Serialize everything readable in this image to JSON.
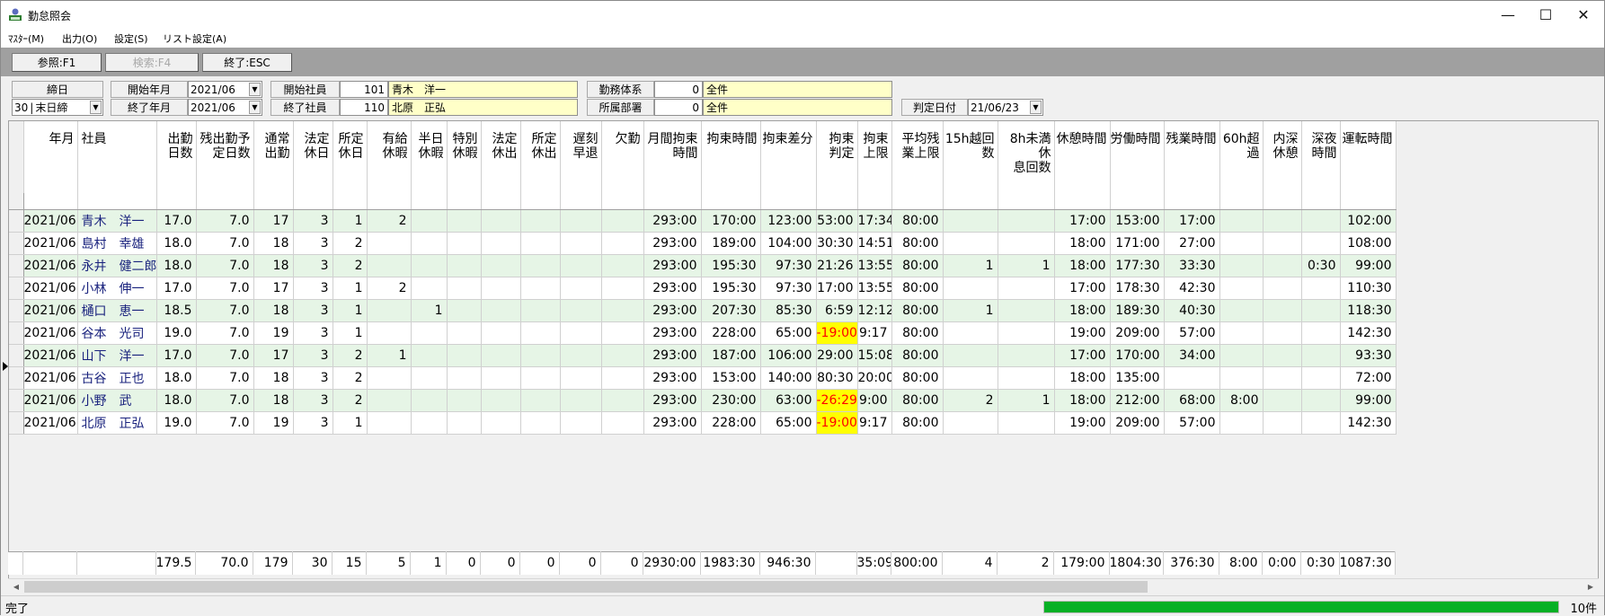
{
  "window": {
    "title": "勤怠照会",
    "minimize": "—",
    "maximize": "☐",
    "close": "✕"
  },
  "menu": [
    "ﾏｽﾀｰ(M)",
    "出力(O)",
    "設定(S)",
    "リスト設定(A)"
  ],
  "toolbar": {
    "ref": "参照:F1",
    "search": "検索:F4",
    "exit": "終了:ESC"
  },
  "filters": {
    "closing_day_label": "締日",
    "closing_day_num": "30",
    "closing_day_value": "末日締",
    "start_month_label": "開始年月",
    "start_month_value": "2021/06",
    "end_month_label": "終了年月",
    "end_month_value": "2021/06",
    "start_emp_label": "開始社員",
    "start_emp_code": "101",
    "start_emp_name": "青木　洋一",
    "end_emp_label": "終了社員",
    "end_emp_code": "110",
    "end_emp_name": "北原　正弘",
    "work_system_label": "勤務体系",
    "work_system_code": "0",
    "work_system_value": "全件",
    "department_label": "所属部署",
    "department_code": "0",
    "department_value": "全件",
    "judge_date_label": "判定日付",
    "judge_date_value": "21/06/23"
  },
  "columns": [
    [
      "年月"
    ],
    [
      "社員"
    ],
    [
      "出勤",
      "日数"
    ],
    [
      "残出勤予",
      "定日数"
    ],
    [
      "通常",
      "出勤"
    ],
    [
      "法定",
      "休日"
    ],
    [
      "所定",
      "休日"
    ],
    [
      "有給",
      "休暇"
    ],
    [
      "半日",
      "休暇"
    ],
    [
      "特別",
      "休暇"
    ],
    [
      "法定",
      "休出"
    ],
    [
      "所定",
      "休出"
    ],
    [
      "遅刻",
      "早退"
    ],
    [
      "欠勤"
    ],
    [
      "月間拘束",
      "時間"
    ],
    [
      "拘束時間"
    ],
    [
      "拘束差分"
    ],
    [
      "拘束",
      "判定"
    ],
    [
      "拘束",
      "上限"
    ],
    [
      "平均残",
      "業上限"
    ],
    [
      "15h越回",
      "数"
    ],
    [
      "8h未満休",
      "息回数"
    ],
    [
      "休憩時間"
    ],
    [
      "労働時間"
    ],
    [
      "残業時間"
    ],
    [
      "60h超",
      "過"
    ],
    [
      "内深",
      "休憩"
    ],
    [
      "深夜",
      "時間"
    ],
    [
      "運転時間"
    ]
  ],
  "rows": [
    [
      "2021/06",
      "青木　洋一",
      "17.0",
      "7.0",
      "17",
      "3",
      "1",
      "2",
      "",
      "",
      "",
      "",
      "",
      "",
      "293:00",
      "170:00",
      "123:00",
      "53:00",
      "17:34",
      "80:00",
      "",
      "",
      "17:00",
      "153:00",
      "17:00",
      "",
      "",
      "",
      "102:00"
    ],
    [
      "2021/06",
      "島村　幸雄",
      "18.0",
      "7.0",
      "18",
      "3",
      "2",
      "",
      "",
      "",
      "",
      "",
      "",
      "",
      "293:00",
      "189:00",
      "104:00",
      "30:30",
      "14:51",
      "80:00",
      "",
      "",
      "18:00",
      "171:00",
      "27:00",
      "",
      "",
      "",
      "108:00"
    ],
    [
      "2021/06",
      "永井　健二郎",
      "18.0",
      "7.0",
      "18",
      "3",
      "2",
      "",
      "",
      "",
      "",
      "",
      "",
      "",
      "293:00",
      "195:30",
      "97:30",
      "21:26",
      "13:55",
      "80:00",
      "1",
      "1",
      "18:00",
      "177:30",
      "33:30",
      "",
      "",
      "0:30",
      "99:00"
    ],
    [
      "2021/06",
      "小林　伸一",
      "17.0",
      "7.0",
      "17",
      "3",
      "1",
      "2",
      "",
      "",
      "",
      "",
      "",
      "",
      "293:00",
      "195:30",
      "97:30",
      "17:00",
      "13:55",
      "80:00",
      "",
      "",
      "17:00",
      "178:30",
      "42:30",
      "",
      "",
      "",
      "110:30"
    ],
    [
      "2021/06",
      "樋口　恵一",
      "18.5",
      "7.0",
      "18",
      "3",
      "1",
      "",
      "1",
      "",
      "",
      "",
      "",
      "",
      "293:00",
      "207:30",
      "85:30",
      "6:59",
      "12:12",
      "80:00",
      "1",
      "",
      "18:00",
      "189:30",
      "40:30",
      "",
      "",
      "",
      "118:30"
    ],
    [
      "2021/06",
      "谷本　光司",
      "19.0",
      "7.0",
      "19",
      "3",
      "1",
      "",
      "",
      "",
      "",
      "",
      "",
      "",
      "293:00",
      "228:00",
      "65:00",
      "-19:00",
      "9:17",
      "80:00",
      "",
      "",
      "19:00",
      "209:00",
      "57:00",
      "",
      "",
      "",
      "142:30"
    ],
    [
      "2021/06",
      "山下　洋一",
      "17.0",
      "7.0",
      "17",
      "3",
      "2",
      "1",
      "",
      "",
      "",
      "",
      "",
      "",
      "293:00",
      "187:00",
      "106:00",
      "29:00",
      "15:08",
      "80:00",
      "",
      "",
      "17:00",
      "170:00",
      "34:00",
      "",
      "",
      "",
      "93:30"
    ],
    [
      "2021/06",
      "古谷　正也",
      "18.0",
      "7.0",
      "18",
      "3",
      "2",
      "",
      "",
      "",
      "",
      "",
      "",
      "",
      "293:00",
      "153:00",
      "140:00",
      "80:30",
      "20:00",
      "80:00",
      "",
      "",
      "18:00",
      "135:00",
      "",
      "",
      "",
      "",
      "72:00"
    ],
    [
      "2021/06",
      "小野　武",
      "18.0",
      "7.0",
      "18",
      "3",
      "2",
      "",
      "",
      "",
      "",
      "",
      "",
      "",
      "293:00",
      "230:00",
      "63:00",
      "-26:29",
      "9:00",
      "80:00",
      "2",
      "1",
      "18:00",
      "212:00",
      "68:00",
      "8:00",
      "",
      "",
      "99:00"
    ],
    [
      "2021/06",
      "北原　正弘",
      "19.0",
      "7.0",
      "19",
      "3",
      "1",
      "",
      "",
      "",
      "",
      "",
      "",
      "",
      "293:00",
      "228:00",
      "65:00",
      "-19:00",
      "9:17",
      "80:00",
      "",
      "",
      "19:00",
      "209:00",
      "57:00",
      "",
      "",
      "",
      "142:30"
    ]
  ],
  "totals": [
    "",
    "",
    "179.5",
    "70.0",
    "179",
    "30",
    "15",
    "5",
    "1",
    "0",
    "0",
    "0",
    "0",
    "0",
    "2930:00",
    "1983:30",
    "946:30",
    "",
    "35:09",
    "800:00",
    "4",
    "2",
    "179:00",
    "1804:30",
    "376:30",
    "8:00",
    "0:00",
    "0:30",
    "1087:30"
  ],
  "status": {
    "text": "完了",
    "progress": 1.0,
    "count": "10件"
  },
  "colors": {
    "row_green": "#e6f5e6",
    "warn_bg": "#ffff00",
    "warn_fg": "#ff0000",
    "name_fg": "#1a237e",
    "progress": "#06b025"
  }
}
